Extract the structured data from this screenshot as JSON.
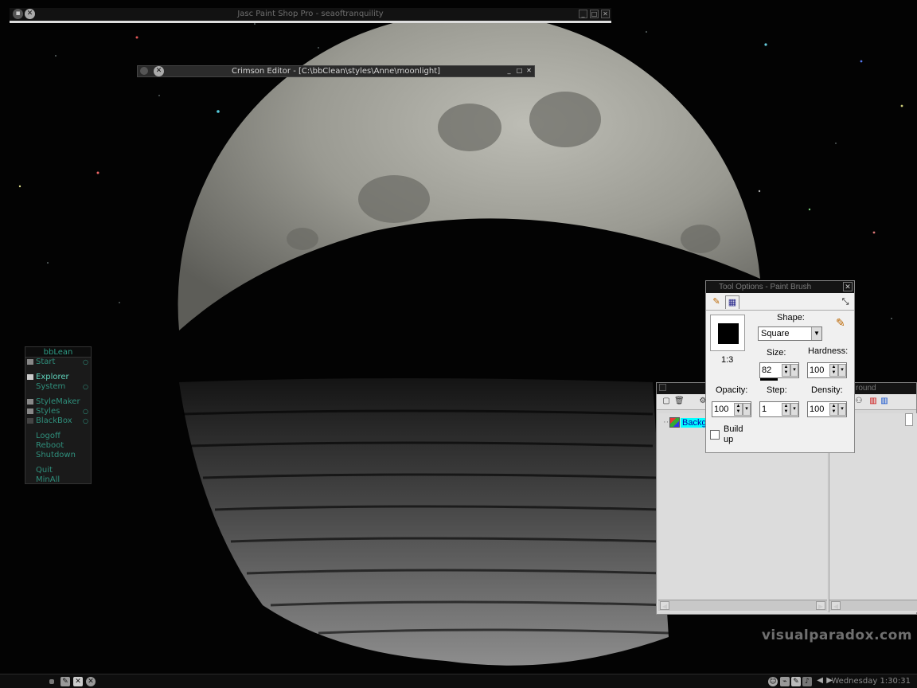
{
  "desktop": {
    "watermark": "visualparadox.com"
  },
  "windows": {
    "psp_title": "Jasc Paint Shop Pro - seaoftranquility",
    "crimson_title": "Crimson Editor - [C:\\bbClean\\styles\\Anne\\moonlight]"
  },
  "bblean": {
    "title": "bbLean",
    "items": [
      {
        "label": "Start",
        "icon": "folder-icon",
        "submenu": true
      },
      {
        "label": "Explorer",
        "icon": "computer-icon",
        "active": true
      },
      {
        "label": "System",
        "submenu": true
      },
      {
        "label": "StyleMaker",
        "icon": "app-icon"
      },
      {
        "label": "Styles",
        "icon": "folder-icon",
        "submenu": true
      },
      {
        "label": "BlackBox",
        "icon": "blackbox-icon",
        "submenu": true
      },
      {
        "label": "Logoff"
      },
      {
        "label": "Reboot"
      },
      {
        "label": "Shutdown"
      },
      {
        "label": "Quit"
      },
      {
        "label": "MinAll"
      }
    ]
  },
  "tool_options": {
    "title": "Tool Options - Paint Brush",
    "preview_ratio": "1:3",
    "shape_label": "Shape:",
    "shape_value": "Square",
    "size_label": "Size:",
    "size_value": "82",
    "hardness_label": "Hardness:",
    "hardness_value": "100",
    "opacity_label": "Opacity:",
    "opacity_value": "100",
    "step_label": "Step:",
    "step_value": "1",
    "density_label": "Density:",
    "density_value": "100",
    "buildup_label_1": "Build",
    "buildup_label_2": "up",
    "buildup_checked": false
  },
  "layer_palette": {
    "title_fragment": "round",
    "layer_name": "Backg"
  },
  "taskbar": {
    "clock": "Wednesday 1:30:31"
  },
  "colors": {
    "menu_text": "#2f8f7c",
    "menu_active": "#5fd3bc",
    "layer_highlight": "#00ffff"
  }
}
